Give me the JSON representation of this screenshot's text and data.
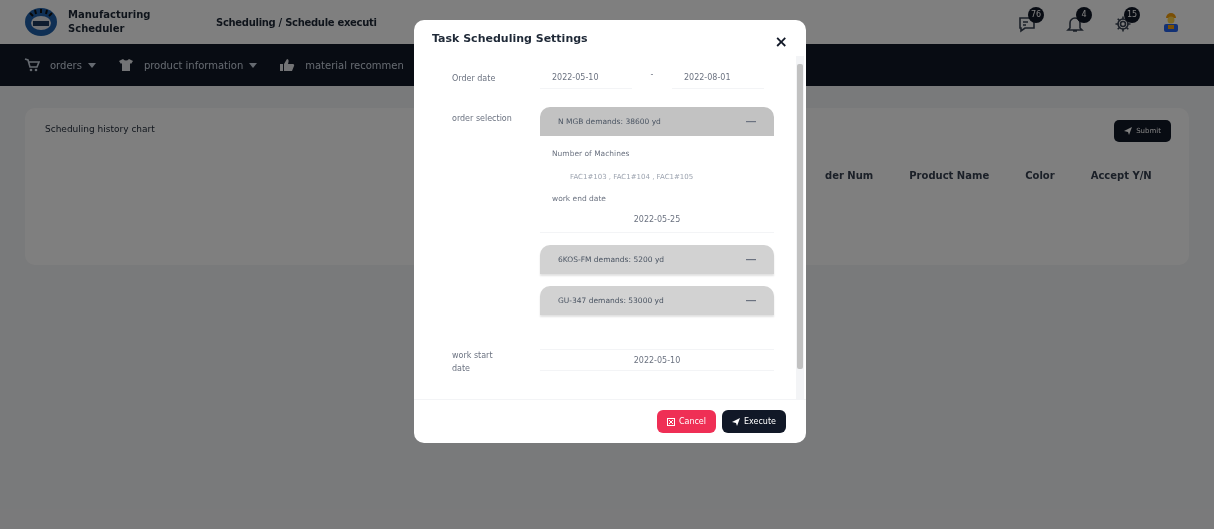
{
  "header": {
    "app_name": [
      "Manufacturing",
      "Scheduler"
    ],
    "breadcrumb": "Scheduling / Schedule executi",
    "badges": [
      {
        "kind": "chat",
        "count": "76"
      },
      {
        "kind": "bell",
        "count": "4"
      },
      {
        "kind": "gear",
        "count": "15"
      }
    ]
  },
  "nav": [
    {
      "kind": "cart",
      "label": "orders",
      "dropdown": true
    },
    {
      "kind": "shirt",
      "label": "product information",
      "dropdown": true
    },
    {
      "kind": "thumb",
      "label": "material recommen",
      "dropdown": false
    }
  ],
  "card": {
    "title": "Scheduling history chart",
    "submit": "Submit",
    "columns": [
      "der Num",
      "Product Name",
      "Color",
      "Accept Y/N"
    ]
  },
  "dialog": {
    "title": "Task Scheduling Settings",
    "close": "×",
    "order_date": {
      "label": "Order date",
      "from": "2022-05-10",
      "separator": "-",
      "to": "2022-08-01"
    },
    "order_selection": {
      "label": "order selection",
      "orders": [
        {
          "title": "N MGB demands: 38600 yd",
          "expanded": true,
          "machines_label": "Number of Machines",
          "machines": "FAC1#103 , FAC1#104 , FAC1#105",
          "end_label": "work end date",
          "end_date": "2022-05-25"
        },
        {
          "title": "6KOS-FM demands: 5200 yd",
          "expanded": false
        },
        {
          "title": "GU-347 demands: 53000 yd",
          "expanded": false
        }
      ]
    },
    "work_start": {
      "label": "work start date",
      "value": "2022-05-10"
    },
    "buttons": [
      {
        "kind": "cancel",
        "label": "Cancel"
      },
      {
        "kind": "execute",
        "label": "Execute"
      }
    ]
  }
}
